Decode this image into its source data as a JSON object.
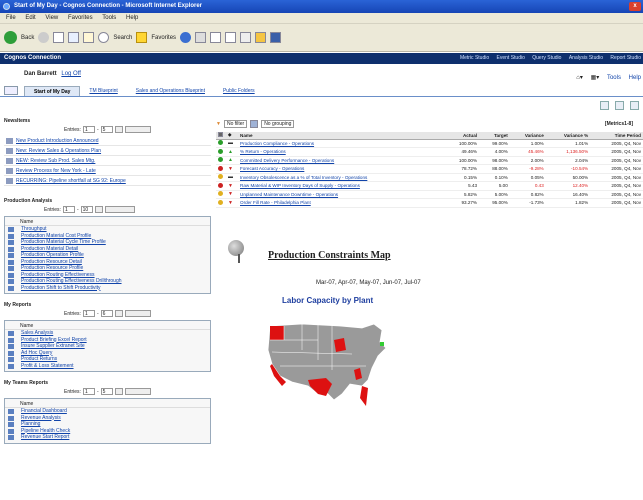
{
  "window": {
    "title": "Start of My Day - Cognos Connection - Microsoft Internet Explorer",
    "close": "x"
  },
  "menu": [
    "File",
    "Edit",
    "View",
    "Favorites",
    "Tools",
    "Help"
  ],
  "toolbar": {
    "back": "Back",
    "search": "Search",
    "favorites": "Favorites"
  },
  "cognos": {
    "title": "Cognos Connection",
    "links": [
      "Metric Studio",
      "Event Studio",
      "Query Studio",
      "Analysis Studio",
      "Report Studio"
    ]
  },
  "user": {
    "name": "Dan Barrett",
    "logoff": "Log Off",
    "tools": "Tools",
    "help": "Help"
  },
  "tabs": [
    "Start of My Day",
    "TM Blueprint",
    "Sales and Operations Blueprint",
    "Public Folders"
  ],
  "newsitems": {
    "title": "NewsItems",
    "entries_label": "Entries:",
    "entries_from": "1",
    "entries_to": "5",
    "items": [
      "New Product Introduction Announced",
      "New: Review Sales & Operations Plan",
      "NEW: Review Sub Prod. Sales Mtg.",
      "Review Process for New York - Late",
      "RECURRING: Pipeline shortfall at SG 92: Europe"
    ]
  },
  "production_analysis": {
    "title": "Production Analysis",
    "entries_label": "Entries:",
    "entries_from": "1",
    "entries_to": "10",
    "head": "Name",
    "items": [
      "Throughput",
      "Production Material Cost Profile",
      "Production Material Cycle Time Profile",
      "Production Material Detail",
      "Production Operation Profile",
      "Production Resource Detail",
      "Production Resource Profile",
      "Production Routing Effectiveness",
      "Production Routing Effectiveness Drillthrough",
      "Production Shift to Shift Productivity"
    ]
  },
  "my_reports": {
    "title": "My Reports",
    "entries_label": "Entries:",
    "entries_from": "1",
    "entries_to": "6",
    "head": "Name",
    "items": [
      "Sales Analysis",
      "Product Briefing Excel Report",
      "Insure Supplier Extranet Site",
      "Ad Hoc Query",
      "Product Returns",
      "Profit & Loss Statement"
    ]
  },
  "my_teams_reports": {
    "title": "My Teams Reports",
    "entries_label": "Entries:",
    "entries_from": "1",
    "entries_to": "5",
    "head": "Name",
    "items": [
      "Financial Dashboard",
      "Revenue Analysis",
      "Planning",
      "Pipeline Health Check",
      "Revenue Start Report"
    ]
  },
  "metrics": {
    "filter": "No filter",
    "grouping": "No grouping",
    "title": "[Metrics1-8]",
    "columns": [
      "Name",
      "Actual",
      "Target",
      "Variance",
      "Variance %",
      "Time Period"
    ],
    "rows": [
      {
        "status_color": "#2a9d2a",
        "trend": "-",
        "name": "Production Compliance - Operations",
        "actual": "100.00%",
        "target": "99.00%",
        "variance": "1.00%",
        "variance_pct": "1.01%",
        "period": "2005, Q4, Nov",
        "neg": false
      },
      {
        "status_color": "#2a9d2a",
        "trend": "up",
        "name": "% Return - Operations",
        "actual": "49.46%",
        "target": "4.00%",
        "variance": "45.46%",
        "variance_pct": "1,136.50%",
        "period": "2005, Q4, Nov",
        "neg": true
      },
      {
        "status_color": "#2a9d2a",
        "trend": "up",
        "name": "Committed Delivery Performance - Operations",
        "actual": "100.00%",
        "target": "98.00%",
        "variance": "2.00%",
        "variance_pct": "2.04%",
        "period": "2005, Q4, Nov",
        "neg": false
      },
      {
        "status_color": "#cc2222",
        "trend": "down",
        "name": "Forecast Accuracy - Operations",
        "actual": "78.72%",
        "target": "88.00%",
        "variance": "-9.28%",
        "variance_pct": "-10.54%",
        "period": "2005, Q4, Nov",
        "neg": true
      },
      {
        "status_color": "#e0b020",
        "trend": "-",
        "name": "Inventory Obsolescence as a % of Total Inventory - Operations",
        "actual": "0.15%",
        "target": "0.10%",
        "variance": "0.05%",
        "variance_pct": "50.00%",
        "period": "2005, Q4, Nov",
        "neg": false
      },
      {
        "status_color": "#cc2222",
        "trend": "down",
        "name": "Raw Material & WIP Inventory Days of Supply - Operations",
        "actual": "5.43",
        "target": "5.00",
        "variance": "0.43",
        "variance_pct": "12.40%",
        "period": "2005, Q4, Nov",
        "neg": true
      },
      {
        "status_color": "#e0b020",
        "trend": "down",
        "name": "Unplanned Maintenance Downtime - Operations",
        "actual": "5.82%",
        "target": "5.00%",
        "variance": "0.82%",
        "variance_pct": "16.40%",
        "period": "2005, Q4, Nov",
        "neg": false
      },
      {
        "status_color": "#e0b020",
        "trend": "down",
        "name": "Order Fill Rate - Philadelphia Plant",
        "actual": "93.27%",
        "target": "95.00%",
        "variance": "-1.73%",
        "variance_pct": "1.82%",
        "period": "2005, Q4, Nov",
        "neg": false
      }
    ]
  },
  "constraints": {
    "title": "Production Constraints Map",
    "dates": "Mar-07, Apr-07, May-07, Jun-07, Jul-07",
    "subtitle": "Labor Capacity by Plant"
  }
}
